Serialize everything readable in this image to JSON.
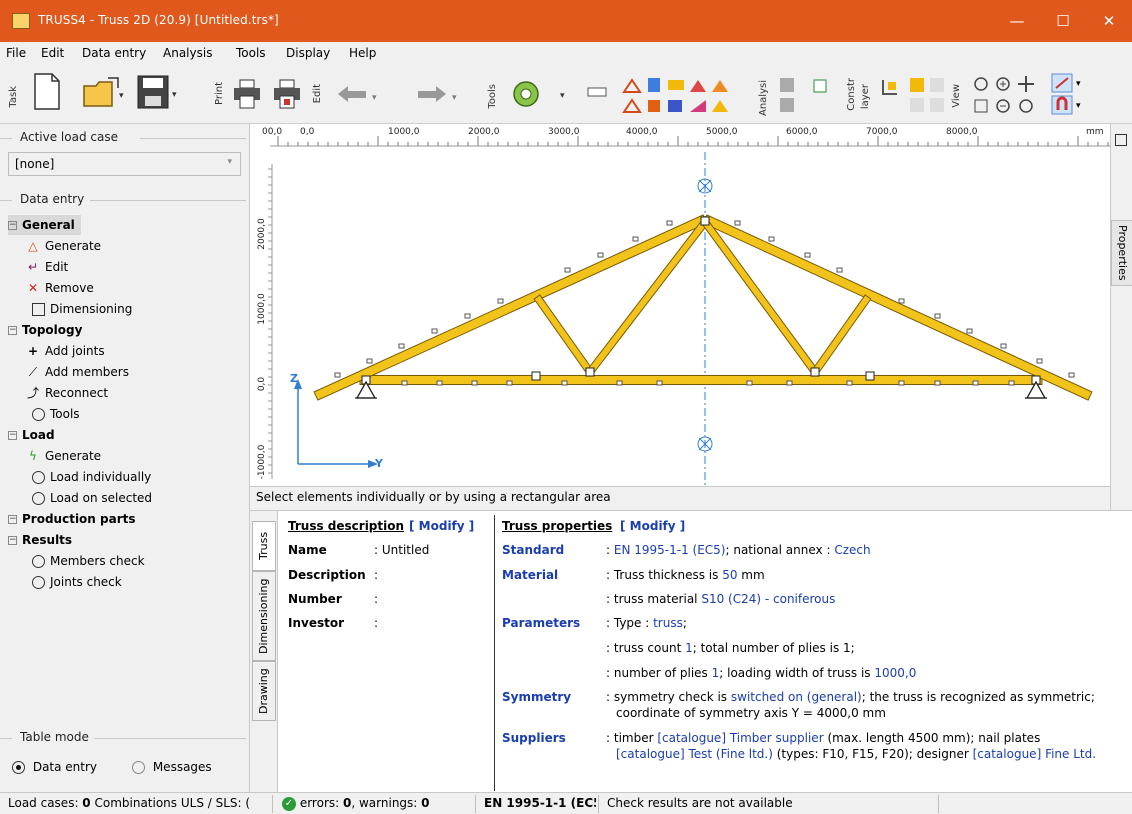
{
  "window": {
    "title": "TRUSS4 - Truss 2D  (20.9)  [Untitled.trs*]",
    "minimize": "—",
    "maximize": "☐",
    "close": "✕"
  },
  "menu": [
    "File",
    "Edit",
    "Data entry",
    "Analysis",
    "Tools",
    "Display",
    "Help"
  ],
  "toolbar": {
    "task_label": "Task",
    "print_label": "Print",
    "edit_label": "Edit",
    "tools_label": "Tools",
    "analysis_label": "Analysi",
    "construct_label": "Constr",
    "layer_label": "layer",
    "view_label": "View"
  },
  "left": {
    "active_load_case_label": "Active load case",
    "active_load_case_value": "[none]",
    "data_entry_label": "Data entry",
    "tree": [
      {
        "label": "General",
        "type": "group",
        "bold": true
      },
      {
        "label": "Generate",
        "type": "item",
        "icon": "generate-truss-icon"
      },
      {
        "label": "Edit",
        "type": "item",
        "icon": "edit-arrow-icon"
      },
      {
        "label": "Remove",
        "type": "item",
        "icon": "remove-x-icon"
      },
      {
        "label": "Dimensioning",
        "type": "item",
        "icon": "square-icon"
      },
      {
        "label": "Topology",
        "type": "group",
        "bold": true
      },
      {
        "label": "Add joints",
        "type": "item",
        "icon": "plus-icon"
      },
      {
        "label": "Add members",
        "type": "item",
        "icon": "line-icon"
      },
      {
        "label": "Reconnect",
        "type": "item",
        "icon": "reconnect-icon"
      },
      {
        "label": "Tools",
        "type": "item",
        "icon": "circle-icon"
      },
      {
        "label": "Load",
        "type": "group",
        "bold": true
      },
      {
        "label": "Generate",
        "type": "item",
        "icon": "lightning-icon"
      },
      {
        "label": "Load individually",
        "type": "item",
        "icon": "circle-icon"
      },
      {
        "label": "Load on selected",
        "type": "item",
        "icon": "circle-icon"
      },
      {
        "label": "Production parts",
        "type": "group",
        "bold": true
      },
      {
        "label": "Results",
        "type": "group",
        "bold": true
      },
      {
        "label": "Members check",
        "type": "item",
        "icon": "circle-icon"
      },
      {
        "label": "Joints check",
        "type": "item",
        "icon": "circle-icon"
      }
    ],
    "table_mode_label": "Table mode",
    "table_mode_options": [
      "Data entry",
      "Messages"
    ],
    "table_mode_selected": "Data entry"
  },
  "canvas": {
    "ruler_ticks": [
      "00,0",
      "0,0",
      "1000,0",
      "2000,0",
      "3000,0",
      "4000,0",
      "5000,0",
      "6000,0",
      "7000,0",
      "8000,0"
    ],
    "ruler_unit": "mm",
    "vertical_ticks": [
      "2000,0",
      "1000,0",
      "0,0",
      "-1000,0"
    ],
    "axis_z": "Z",
    "axis_y": "Y",
    "truss_color": "#f2c31a",
    "truss_outline": "#7a5a00",
    "status_text": "Select elements individually or by  using a rectangular area"
  },
  "properties_tab": "Properties",
  "bottom": {
    "tabs": [
      "Truss",
      "Dimensioning",
      "Drawing"
    ],
    "active_tab": "Truss",
    "truss_description_title": "Truss description",
    "modify": "[ Modify ]",
    "description_rows": [
      {
        "label": "Name",
        "value": ": Untitled"
      },
      {
        "label": "Description",
        "value": ":"
      },
      {
        "label": "Number",
        "value": ":"
      },
      {
        "label": "Investor",
        "value": ":"
      }
    ],
    "truss_properties_title": "Truss properties",
    "properties": {
      "standard_label": "Standard",
      "standard_value_prefix": ": ",
      "standard_link": "EN 1995-1-1 (EC5)",
      "standard_mid": "; national annex : ",
      "standard_annex": "Czech",
      "material_label": "Material",
      "material_line1_prefix": ": Truss thickness is ",
      "material_thickness": "50",
      "material_line1_suffix": " mm",
      "material_line2_prefix": ": truss material ",
      "material_line2_link": "S10 (C24) - coniferous",
      "parameters_label": "Parameters",
      "param_line1_prefix": ": Type : ",
      "param_line1_link": "truss",
      "param_line1_suffix": ";",
      "param_line2_prefix": ": truss count ",
      "param_line2_count": "1",
      "param_line2_suffix": "; total number of plies is 1;",
      "param_line3_prefix": ": number of plies ",
      "param_line3_plies": "1",
      "param_line3_mid": "; loading width of truss is ",
      "param_line3_width": "1000,0",
      "symmetry_label": "Symmetry",
      "sym_line1_prefix": ": symmetry check is ",
      "sym_line1_link": "switched on (general)",
      "sym_line1_suffix": "; the truss is recognized as symmetric;",
      "sym_line2": "coordinate of symmetry axis  Y = 4000,0 mm",
      "suppliers_label": "Suppliers",
      "sup_line1_prefix": ": timber ",
      "sup_line1_link": "[catalogue] Timber supplier",
      "sup_line1_suffix": " (max. length 4500 mm); nail plates",
      "sup_line2_link1": "[catalogue] Test (Fine ltd.)",
      "sup_line2_mid": " (types: F10, F15, F20); designer ",
      "sup_line2_link2": "[catalogue] Fine Ltd."
    }
  },
  "statusbar": {
    "load_cases": "Load cases: ",
    "load_cases_n": "0",
    "combinations": "  Combinations ULS / SLS: (",
    "errors_prefix": "errors: ",
    "errors_n": "0",
    "warnings_prefix": ", warnings: ",
    "warnings_n": "0",
    "standard": "EN 1995-1-1 (EC5",
    "check": "Check results are not available"
  }
}
